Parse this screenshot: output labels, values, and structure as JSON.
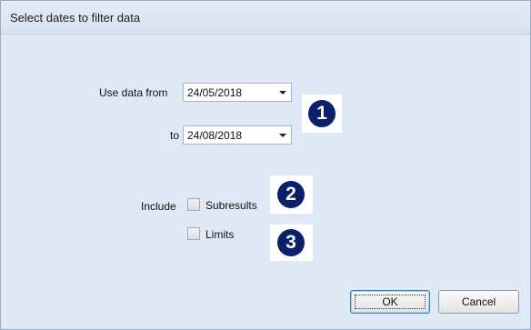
{
  "dialog": {
    "title": "Select dates to filter data"
  },
  "date_filter": {
    "from_label": "Use data from",
    "from_value": "24/05/2018",
    "to_label": "to",
    "to_value": "24/08/2018"
  },
  "include": {
    "label": "Include",
    "options": [
      {
        "label": "Subresults",
        "checked": false
      },
      {
        "label": "Limits",
        "checked": false
      }
    ]
  },
  "callouts": [
    "1",
    "2",
    "3"
  ],
  "colors": {
    "dialog_background": "#dfe9f5",
    "callout_fill": "#0c1f6b"
  },
  "buttons": {
    "ok_label": "OK",
    "cancel_label": "Cancel"
  }
}
